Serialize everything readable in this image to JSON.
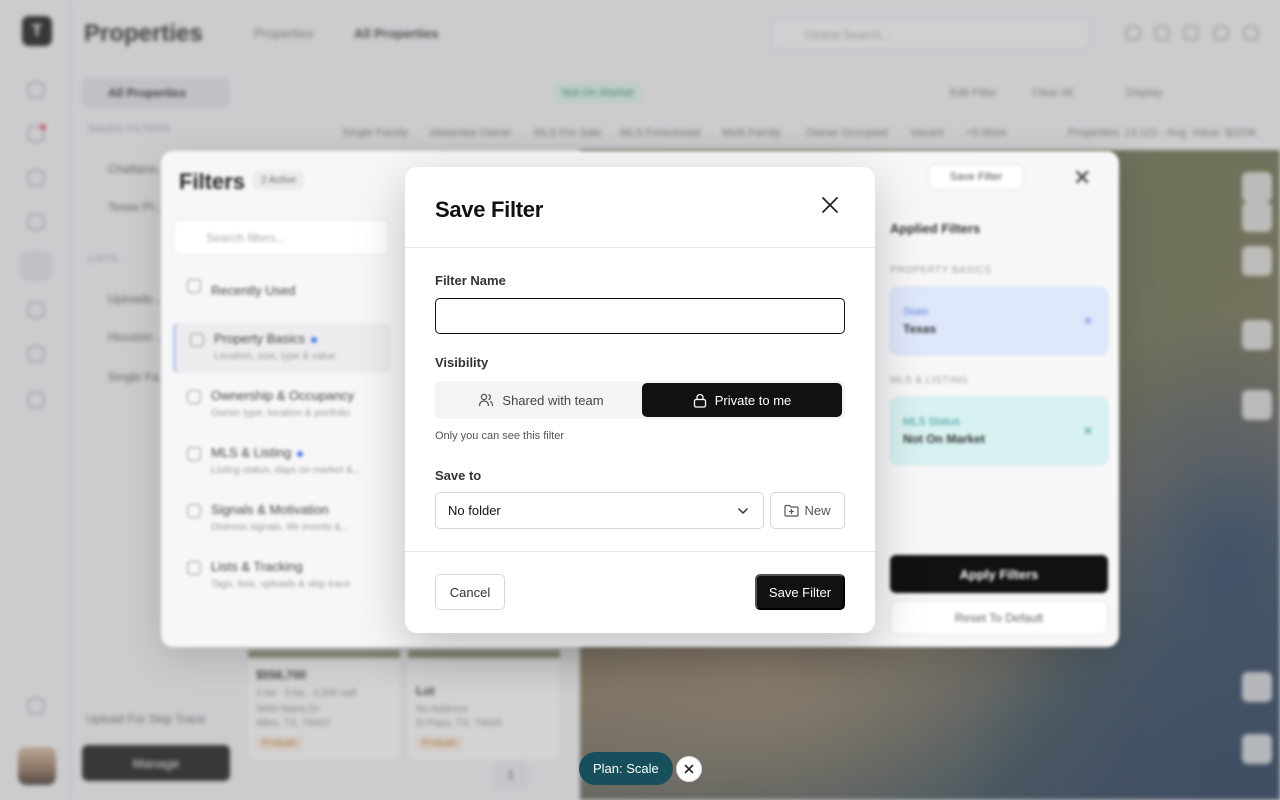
{
  "app": {
    "title": "Properties",
    "logo": "T",
    "breadcrumb": [
      "Properties",
      "All Properties"
    ],
    "global_search_placeholder": "Global Search...",
    "sidebar": {
      "all_properties": "All Properties",
      "saved_filters_label": "SAVED FILTERS",
      "saved_filters": [
        "Chattano...",
        "Texas Pr..."
      ],
      "lists_label": "LISTS",
      "lists": [
        "Uploade...",
        "Houston ...",
        "Single Fa..."
      ],
      "upload_label": "Upload For Skip Trace",
      "manage_label": "Manage"
    },
    "toolbar": {
      "chip": "Not On Market",
      "edit_filter": "Edit Filter",
      "clear_all": "Clear All",
      "display": "Display"
    },
    "quick_filters": [
      "Single Family",
      "Absentee Owner",
      "MLS For Sale",
      "MLS Foreclosed",
      "Multi Family",
      "Owner Occupied",
      "Vacant",
      "+5 More"
    ],
    "stats": "Properties: 13,121 · Avg. Value: $320K",
    "cards": [
      {
        "price": "$556,700",
        "line1": "4 bd · 3 ba · 3,200 sqft",
        "line2": "5600 Maria Dr",
        "line3": "Allen, TX, 75002",
        "tag": "Probate"
      },
      {
        "price": "Lot",
        "line1": "No Address",
        "line2": "El Paso, TX, 79928",
        "line3": "",
        "tag": "Probate"
      }
    ],
    "page_number": "1"
  },
  "filters_panel": {
    "title": "Filters",
    "active_badge": "2 Active",
    "search_placeholder": "Search filters...",
    "recently_used": "Recently Used",
    "categories": [
      {
        "title": "Property Basics",
        "subtitle": "Location, size, type & value",
        "dot": true
      },
      {
        "title": "Ownership & Occupancy",
        "subtitle": "Owner type, location & portfolio",
        "dot": false
      },
      {
        "title": "MLS & Listing",
        "subtitle": "Listing status, days on market &...",
        "dot": true
      },
      {
        "title": "Signals & Motivation",
        "subtitle": "Distress signals, life events &...",
        "dot": false
      },
      {
        "title": "Lists & Tracking",
        "subtitle": "Tags, lists, uploads & skip trace",
        "dot": false
      }
    ],
    "save_filter_label": "Save Filter",
    "applied": {
      "title": "Applied Filters",
      "sections": [
        {
          "label": "PROPERTY BASICS",
          "key": "State",
          "value": "Texas"
        },
        {
          "label": "MLS & LISTING",
          "key": "MLS Status",
          "value": "Not On Market"
        }
      ],
      "apply_label": "Apply Filters",
      "reset_label": "Reset To Default"
    }
  },
  "dialog": {
    "title": "Save Filter",
    "filter_name_label": "Filter Name",
    "filter_name_value": "",
    "visibility_label": "Visibility",
    "visibility_options": [
      "Shared with team",
      "Private to me"
    ],
    "visibility_selected": "Private to me",
    "visibility_hint": "Only you can see this filter",
    "save_to_label": "Save to",
    "folder_selected": "No folder",
    "new_label": "New",
    "cancel_label": "Cancel",
    "save_label": "Save Filter"
  },
  "plan_pill": "Plan: Scale",
  "colors": {
    "primary": "#111111",
    "plan_pill": "#17505c",
    "dot_blue": "#4f7be8",
    "applied_blue": "#dfe7fb",
    "applied_teal": "#d8f1f1"
  }
}
